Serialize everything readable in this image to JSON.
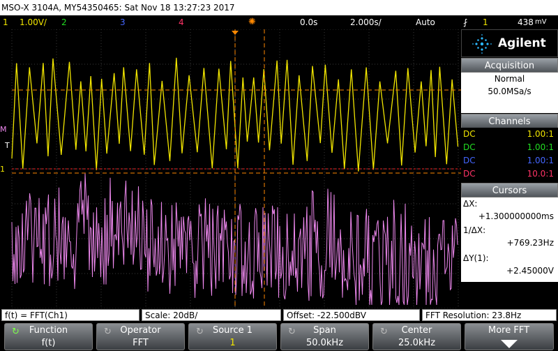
{
  "titlebar": {
    "text": "MSO-X 3104A, MY54350465: Sat Nov 18 13:27:23 2017"
  },
  "status": {
    "ch1_num": "1",
    "ch1_scale": "1.00V/",
    "ch2_num": "2",
    "ch3_num": "3",
    "ch4_num": "4",
    "delay": "0.0s",
    "timebase": "2.000s/",
    "trigger_mode": "Auto",
    "trigger_ch": "1",
    "trigger_level": "438"
  },
  "colors": {
    "ch1": "#f2e600",
    "ch2": "#22dd22",
    "ch3": "#4466ff",
    "ch4": "#ff3366",
    "math": "#ee88ee",
    "cursor": "#ff8800"
  },
  "logo": {
    "brand": "Agilent"
  },
  "acquisition": {
    "title": "Acquisition",
    "mode": "Normal",
    "rate": "50.0MSa/s"
  },
  "channels": {
    "title": "Channels",
    "rows": [
      {
        "coupling": "DC",
        "probe": "1.00:1"
      },
      {
        "coupling": "DC",
        "probe": "1.00:1"
      },
      {
        "coupling": "DC",
        "probe": "1.00:1"
      },
      {
        "coupling": "DC",
        "probe": "10.0:1"
      }
    ]
  },
  "cursors": {
    "title": "Cursors",
    "dx_label": "ΔX:",
    "dx_value": "+1.300000000ms",
    "inv_label": "1/ΔX:",
    "inv_value": "+769.23Hz",
    "dy_label": "ΔY(1):",
    "dy_value": "+2.45000V"
  },
  "screen_marks": {
    "math_marker": "M",
    "trig_marker": "T",
    "ch1_marker": "1"
  },
  "info": {
    "function": "f(t) = FFT(Ch1)",
    "scale": "Scale: 20dB/",
    "offset": "Offset: -22.500dBV",
    "resolution": "FFT Resolution: 23.8Hz"
  },
  "softkeys": [
    {
      "label": "Function",
      "value": "f(t)"
    },
    {
      "label": "Operator",
      "value": "FFT"
    },
    {
      "label": "Source 1",
      "value": "1"
    },
    {
      "label": "Span",
      "value": "50.0kHz"
    },
    {
      "label": "Center",
      "value": "25.0kHz"
    },
    {
      "label": "More FFT",
      "value": ""
    }
  ]
}
